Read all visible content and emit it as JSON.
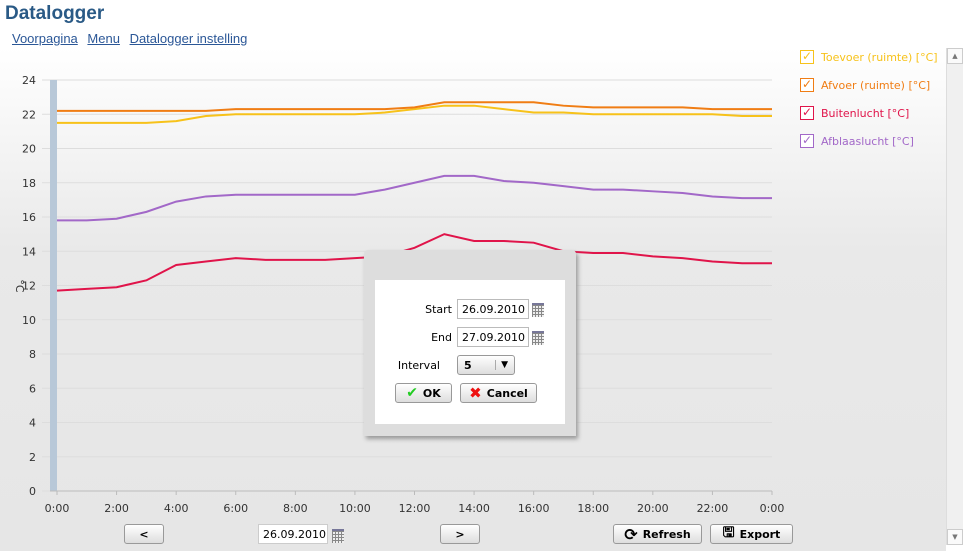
{
  "title": "Datalogger",
  "nav": [
    "Voorpagina",
    "Menu",
    "Datalogger instelling"
  ],
  "colors": {
    "toevoer": "#f7c21a",
    "afvoer": "#f07d14",
    "buiten": "#e0144a",
    "afblaas": "#a268c8"
  },
  "chart_data": {
    "type": "line",
    "ylabel": "°C",
    "ylim": [
      0,
      24
    ],
    "yticks": [
      0,
      2,
      4,
      6,
      8,
      10,
      12,
      14,
      16,
      18,
      20,
      22,
      24
    ],
    "xticks": [
      "0:00",
      "2:00",
      "4:00",
      "6:00",
      "8:00",
      "10:00",
      "12:00",
      "14:00",
      "16:00",
      "18:00",
      "20:00",
      "22:00",
      "0:00"
    ],
    "x_hours": [
      0,
      1,
      2,
      3,
      4,
      5,
      6,
      7,
      8,
      9,
      10,
      11,
      12,
      13,
      14,
      15,
      16,
      17,
      18,
      19,
      20,
      21,
      22,
      23,
      24
    ],
    "grid": true,
    "legend": "right",
    "series": [
      {
        "name": "Toevoer (ruimte) [°C]",
        "color": "#f7c21a",
        "values": [
          21.5,
          21.5,
          21.5,
          21.5,
          21.6,
          21.9,
          22.0,
          22.0,
          22.0,
          22.0,
          22.0,
          22.1,
          22.3,
          22.5,
          22.5,
          22.3,
          22.1,
          22.1,
          22.0,
          22.0,
          22.0,
          22.0,
          22.0,
          21.9,
          21.9
        ]
      },
      {
        "name": "Afvoer (ruimte) [°C]",
        "color": "#f07d14",
        "values": [
          22.2,
          22.2,
          22.2,
          22.2,
          22.2,
          22.2,
          22.3,
          22.3,
          22.3,
          22.3,
          22.3,
          22.3,
          22.4,
          22.7,
          22.7,
          22.7,
          22.7,
          22.5,
          22.4,
          22.4,
          22.4,
          22.4,
          22.3,
          22.3,
          22.3
        ]
      },
      {
        "name": "Buitenlucht [°C]",
        "color": "#e0144a",
        "values": [
          11.7,
          11.8,
          11.9,
          12.3,
          13.2,
          13.4,
          13.6,
          13.5,
          13.5,
          13.5,
          13.6,
          13.7,
          14.2,
          15.0,
          14.6,
          14.6,
          14.5,
          14.0,
          13.9,
          13.9,
          13.7,
          13.6,
          13.4,
          13.3,
          13.3
        ]
      },
      {
        "name": "Afblaaslucht [°C]",
        "color": "#a268c8",
        "values": [
          15.8,
          15.8,
          15.9,
          16.3,
          16.9,
          17.2,
          17.3,
          17.3,
          17.3,
          17.3,
          17.3,
          17.6,
          18.0,
          18.4,
          18.4,
          18.1,
          18.0,
          17.8,
          17.6,
          17.6,
          17.5,
          17.4,
          17.2,
          17.1,
          17.1
        ]
      }
    ]
  },
  "dialog": {
    "start_label": "Start",
    "start": "26.09.2010",
    "end_label": "End",
    "end": "27.09.2010",
    "interval_label": "Interval",
    "interval": "5",
    "ok": "OK",
    "cancel": "Cancel"
  },
  "footer": {
    "prev": "<",
    "date": "26.09.2010",
    "next": ">",
    "refresh": "Refresh",
    "export": "Export"
  }
}
